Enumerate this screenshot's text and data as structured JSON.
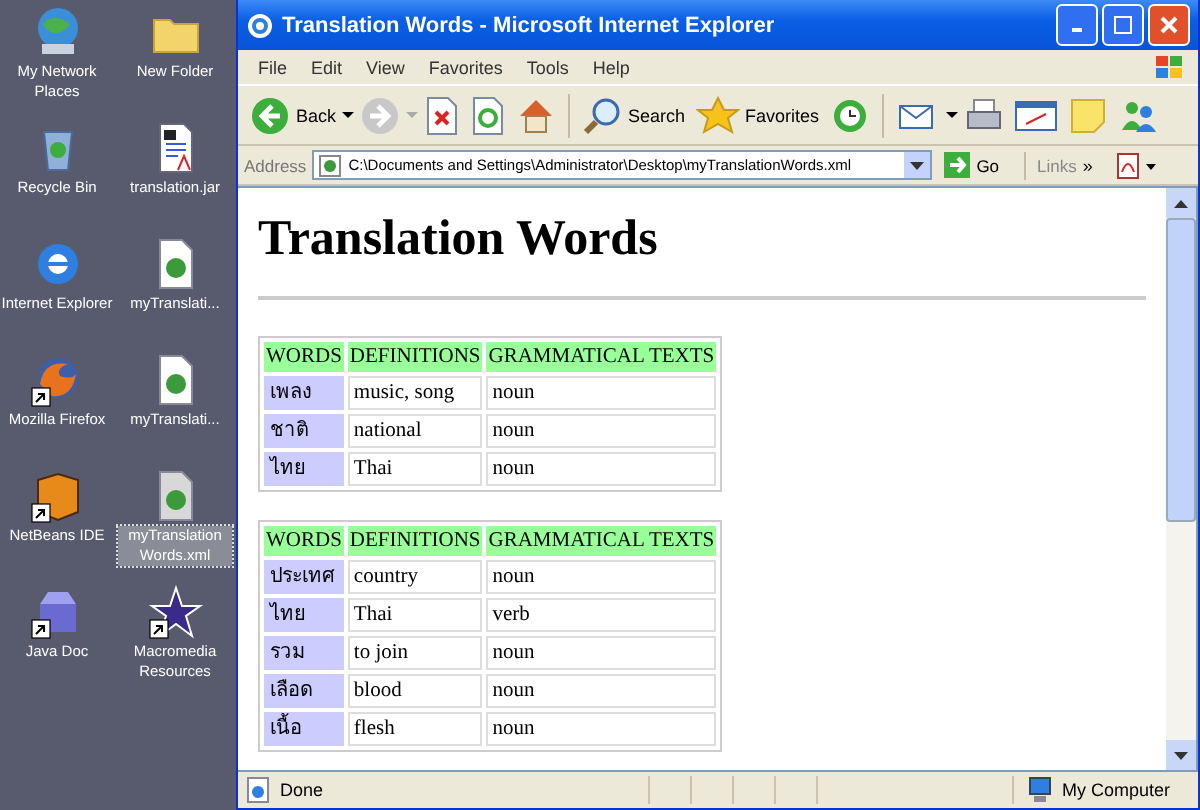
{
  "desktop_icons": [
    {
      "label": "My Network Places",
      "kind": "network",
      "shortcut": false,
      "selected": false
    },
    {
      "label": "New Folder",
      "kind": "folder",
      "shortcut": false,
      "selected": false
    },
    {
      "label": "Recycle Bin",
      "kind": "recycle",
      "shortcut": false,
      "selected": false
    },
    {
      "label": "translation.jar",
      "kind": "jar",
      "shortcut": false,
      "selected": false
    },
    {
      "label": "Internet Explorer",
      "kind": "ie",
      "shortcut": false,
      "selected": false
    },
    {
      "label": "myTranslati...",
      "kind": "xml",
      "shortcut": false,
      "selected": false
    },
    {
      "label": "Mozilla Firefox",
      "kind": "firefox",
      "shortcut": true,
      "selected": false
    },
    {
      "label": "myTranslati...",
      "kind": "xml",
      "shortcut": false,
      "selected": false
    },
    {
      "label": "NetBeans IDE",
      "kind": "netbeans",
      "shortcut": true,
      "selected": false
    },
    {
      "label": "myTranslation Words.xml",
      "kind": "xml",
      "shortcut": false,
      "selected": true
    },
    {
      "label": "Java Doc",
      "kind": "box",
      "shortcut": true,
      "selected": false
    },
    {
      "label": "Macromedia Resources",
      "kind": "star",
      "shortcut": true,
      "selected": false
    }
  ],
  "window": {
    "title": "Translation Words - Microsoft Internet Explorer"
  },
  "menu": [
    "File",
    "Edit",
    "View",
    "Favorites",
    "Tools",
    "Help"
  ],
  "toolbar": {
    "back": "Back",
    "search": "Search",
    "favorites": "Favorites"
  },
  "address_bar": {
    "label": "Address",
    "value": "C:\\Documents and Settings\\Administrator\\Desktop\\myTranslationWords.xml",
    "go": "Go",
    "links": "Links",
    "more": "»"
  },
  "page": {
    "heading": "Translation Words",
    "tables": [
      {
        "columns": [
          "WORDS",
          "DEFINITIONS",
          "GRAMMATICAL TEXTS"
        ],
        "rows": [
          [
            "เพลง",
            "music, song",
            "noun"
          ],
          [
            "ชาติ",
            "national",
            "noun"
          ],
          [
            "ไทย",
            "Thai",
            "noun"
          ]
        ]
      },
      {
        "columns": [
          "WORDS",
          "DEFINITIONS",
          "GRAMMATICAL TEXTS"
        ],
        "rows": [
          [
            "ประเทศ",
            "country",
            "noun"
          ],
          [
            "ไทย",
            "Thai",
            "verb"
          ],
          [
            "รวม",
            "to join",
            "noun"
          ],
          [
            "เลือด",
            "blood",
            "noun"
          ],
          [
            "เนื้อ",
            "flesh",
            "noun"
          ]
        ]
      }
    ]
  },
  "status_bar": {
    "text": "Done",
    "zone": "My Computer"
  }
}
